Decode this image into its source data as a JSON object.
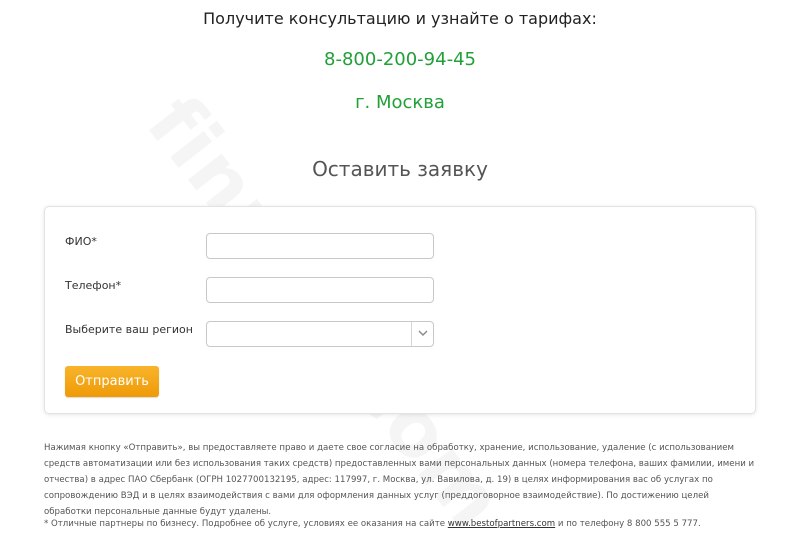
{
  "header": {
    "title": "Получите консультацию и узнайте о тарифах:",
    "phone": "8-800-200-94-45",
    "city": "г. Москва"
  },
  "watermark": "finmru.com",
  "form": {
    "title": "Оставить заявку",
    "fields": {
      "name_label": "ФИО*",
      "name_value": "",
      "phone_label": "Телефон*",
      "phone_value": "",
      "region_label": "Выберите ваш регион",
      "region_value": ""
    },
    "submit_label": "Отправить"
  },
  "legal_text": "Нажимая кнопку «Отправить», вы предоставляете право и даете свое согласие на обработку, хранение, использование, удаление (с использованием средств автоматизации или без использования таких средств) предоставленных вами персональных данных (номера телефона, ваших фамилии, имени и отчества) в адрес ПАО Сбербанк (ОГРН 1027700132195, адрес: 117997, г. Москва, ул. Вавилова, д. 19) в целях информирования вас об услугах по сопровождению ВЭД и в целях взаимодействия с вами для оформления данных услуг (преддоговорное взаимодействие). По достижению целей обработки персональные данные будут удалены.",
  "footnote": {
    "prefix": "* Отличные партнеры по бизнесу. Подробнее об услуге, условиях ее оказания на сайте",
    "link": "www.bestofpartners.com",
    "suffix": "и по телефону 8 800 555 5 777."
  },
  "colors": {
    "accent_green": "#21a038",
    "button_orange": "#f5a623"
  }
}
